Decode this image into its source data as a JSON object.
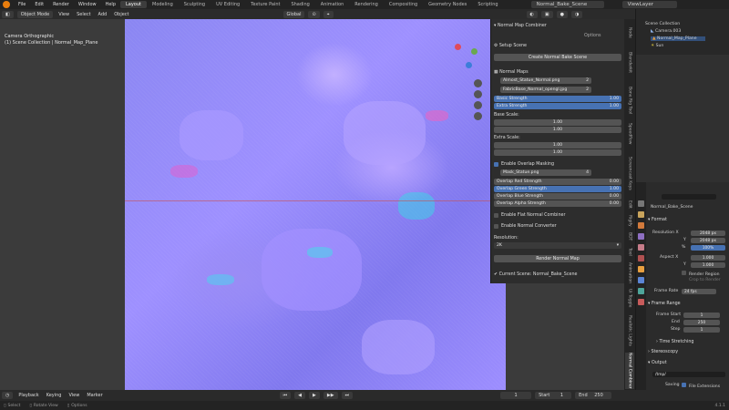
{
  "menu": {
    "items": [
      "File",
      "Edit",
      "Render",
      "Window",
      "Help"
    ]
  },
  "workspaces": [
    "Layout",
    "Modeling",
    "Sculpting",
    "UV Editing",
    "Texture Paint",
    "Shading",
    "Animation",
    "Rendering",
    "Compositing",
    "Geometry Nodes",
    "Scripting"
  ],
  "scene_name": "Normal_Bake_Scene",
  "view_layer": "ViewLayer",
  "header": {
    "mode": "Object Mode",
    "menus": [
      "View",
      "Select",
      "Add",
      "Object"
    ],
    "transform": "Global"
  },
  "viewport": {
    "line1": "Camera Orthographic",
    "line2": "(1) Scene Collection | Normal_Map_Plane",
    "options": "Options"
  },
  "panel": {
    "title": "Normal Map Combiner",
    "setup_scene": "Setup Scene",
    "create_scene_btn": "Create Normal Bake Scene",
    "normal_maps_title": "Normal Maps",
    "map1": "Almost_Statue_Normal.png",
    "map1_users": "2",
    "map2": "FabricBase_Normal_opengl.jpg",
    "map2_users": "2",
    "basic_strength_label": "Basic Strength",
    "basic_strength": "1.00",
    "extra_strength_label": "Extra Strength",
    "extra_strength": "1.00",
    "base_scale_label": "Base Scale:",
    "base_scale_x": "1.00",
    "base_scale_y": "1.00",
    "extra_scale_label": "Extra Scale:",
    "extra_scale_x": "1.00",
    "extra_scale_y": "1.00",
    "overlap_masking": "Enable Overlap Masking",
    "mask": "Mask_Statue.png",
    "mask_users": "4",
    "red_label": "Overlap Red Strength",
    "red": "0.00",
    "green_label": "Overlap Green Strength",
    "green": "1.00",
    "blue_label": "Overlap Blue Strength",
    "blue": "0.00",
    "alpha_label": "Overlap Alpha Strength",
    "alpha": "0.00",
    "flat_normal": "Enable Flat Normal Combiner",
    "normal_converter": "Enable Normal Converter",
    "resolution_label": "Resolution:",
    "resolution": "2K",
    "render_btn": "Render Normal Map",
    "current_scene": "Current Scene: Normal_Bake_Scene"
  },
  "side_tabs": [
    "Normal Combiner",
    "Realistic Lights",
    "Ui Toggle",
    "Animation",
    "Tool",
    "BDT",
    "Rigify",
    "Edit",
    "Screencast Keys",
    "Speedflow",
    "Bone Rig Tool",
    "Blenderkit",
    "Node"
  ],
  "outliner": {
    "root": "Scene Collection",
    "items": [
      "Camera.003",
      "Normal_Map_Plane",
      "Sun"
    ]
  },
  "props": {
    "scene": "Normal_Bake_Scene",
    "format_title": "Format",
    "res_x_label": "Resolution X",
    "res_x": "2048 px",
    "res_y_label": "Y",
    "res_y": "2048 px",
    "res_pct_label": "%",
    "res_pct": "100%",
    "aspect_x_label": "Aspect X",
    "aspect_x": "1.000",
    "aspect_y_label": "Y",
    "aspect_y": "1.000",
    "render_region": "Render Region",
    "crop": "Crop to Render",
    "frame_rate_label": "Frame Rate",
    "frame_rate": "24 fps",
    "frame_range_title": "Frame Range",
    "frame_start_label": "Frame Start",
    "frame_start": "1",
    "end_label": "End",
    "end": "250",
    "step_label": "Step",
    "step": "1",
    "time_stretching": "Time Stretching",
    "stereoscopy": "Stereoscopy",
    "output_title": "Output",
    "output_path": "/tmp/",
    "saving_label": "Saving",
    "file_ext": "File Extensions",
    "cache_result": "Cache Result",
    "file_format_label": "File Format",
    "file_format": "PNG"
  },
  "timeline": {
    "menus": [
      "Playback",
      "Keying",
      "View",
      "Marker"
    ],
    "current": "1",
    "start_label": "Start",
    "start": "1",
    "end_label": "End",
    "end": "250"
  },
  "status": {
    "select": "Select",
    "rotate": "Rotate View",
    "options": "Options",
    "version": "4.1.1"
  }
}
